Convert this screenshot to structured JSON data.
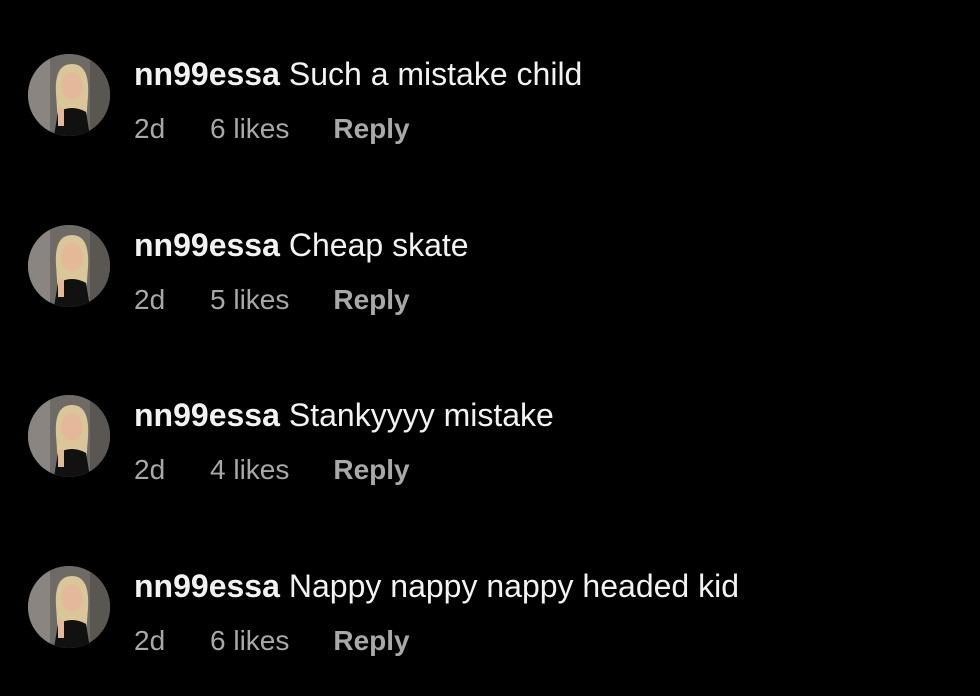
{
  "comments": [
    {
      "username": "nn99essa",
      "text": "Such a mistake child",
      "time": "2d",
      "likes": "6 likes",
      "reply": "Reply"
    },
    {
      "username": "nn99essa",
      "text": "Cheap skate",
      "time": "2d",
      "likes": "5 likes",
      "reply": "Reply"
    },
    {
      "username": "nn99essa",
      "text": "Stankyyyy mistake",
      "time": "2d",
      "likes": "4 likes",
      "reply": "Reply"
    },
    {
      "username": "nn99essa",
      "text": "Nappy nappy nappy headed kid",
      "time": "2d",
      "likes": "6 likes",
      "reply": "Reply"
    }
  ],
  "colors": {
    "background": "#000000",
    "text": "#f2f2f2",
    "meta": "#a8a8a8"
  }
}
